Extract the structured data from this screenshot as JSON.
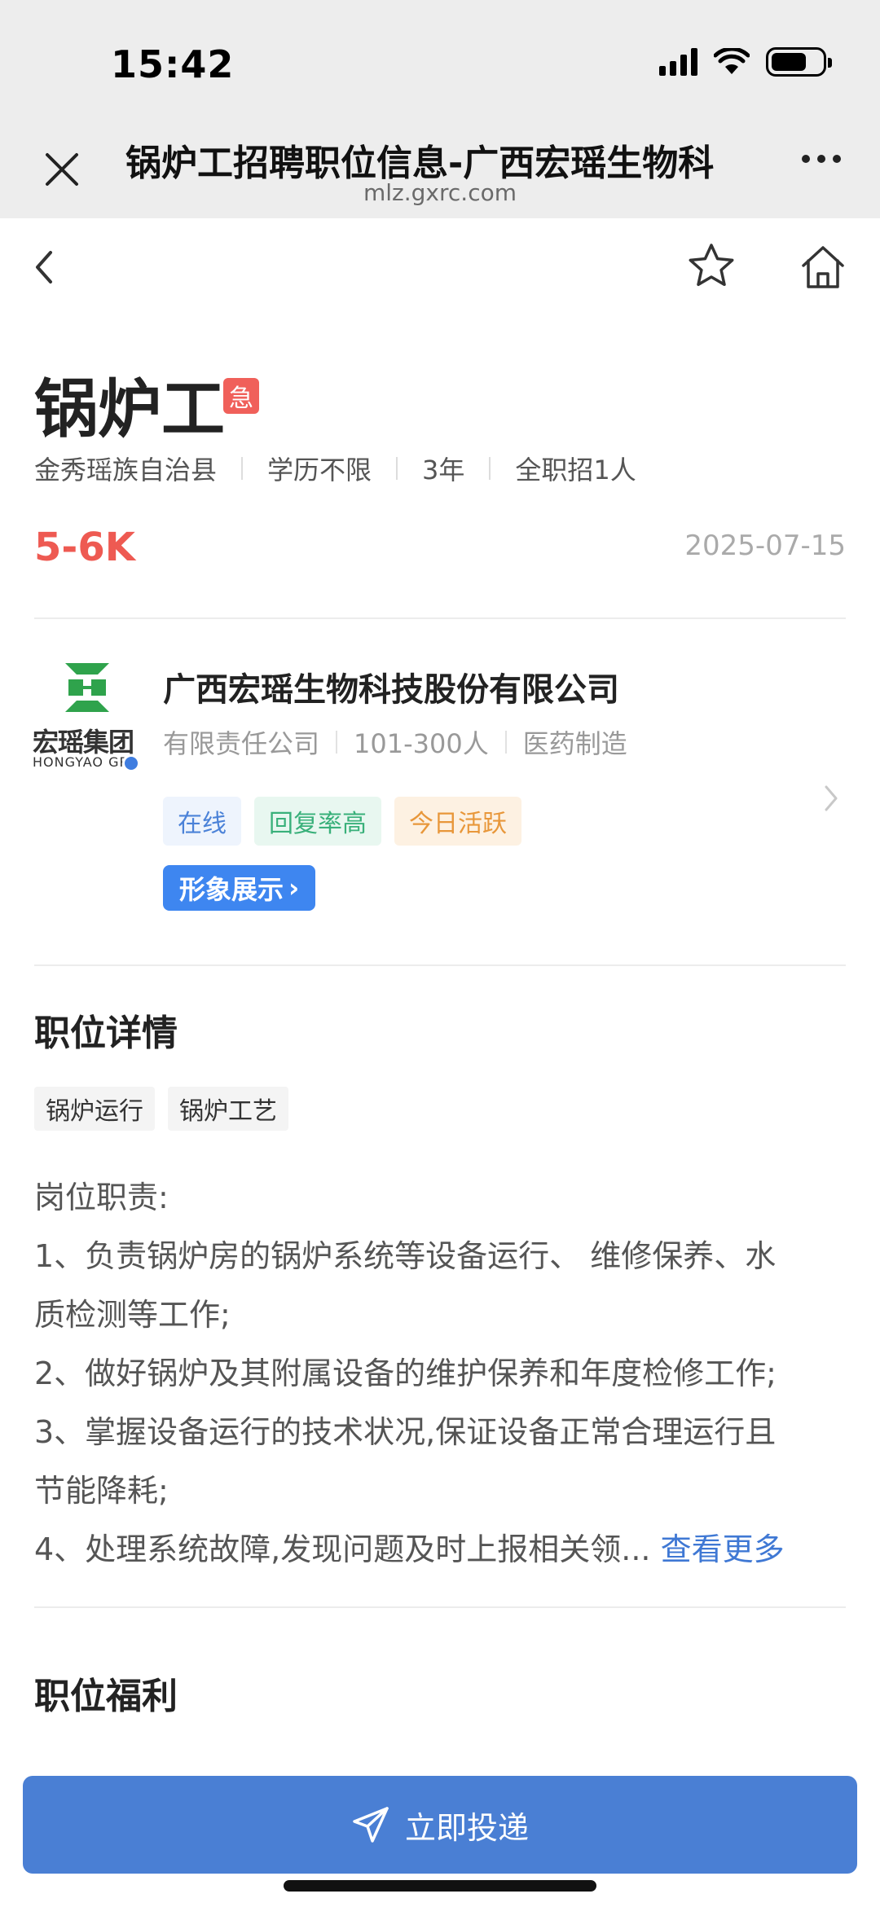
{
  "status_bar": {
    "time": "15:42"
  },
  "browser": {
    "title": "锅炉工招聘职位信息-广西宏瑶生物科",
    "url": "mlz.gxrc.com"
  },
  "icons": {
    "close": "close-icon",
    "more": "more-dots-icon",
    "back": "chevron-left-icon",
    "favorite": "star-icon",
    "home": "home-icon",
    "send": "paper-plane-icon"
  },
  "job": {
    "title": "锅炉工",
    "urgent_badge": "急",
    "location": "金秀瑶族自治县",
    "education": "学历不限",
    "experience": "3年",
    "type": "全职招1人",
    "salary": "5-6K",
    "date": "2025-07-15"
  },
  "company": {
    "logo_text": "宏瑶集团",
    "logo_subtext": "HONGYAO GRO",
    "name": "广西宏瑶生物科技股份有限公司",
    "kind": "有限责任公司",
    "size": "101-300人",
    "industry": "医药制造",
    "tags": [
      "在线",
      "回复率高",
      "今日活跃"
    ],
    "showcase_label": "形象展示",
    "showcase_arrow": "›"
  },
  "details": {
    "section_title": "职位详情",
    "skill_tags": [
      "锅炉运行",
      "锅炉工艺"
    ],
    "lines": [
      "岗位职责:",
      "1、负责锅炉房的锅炉系统等设备运行、 维修保养、水",
      "质检测等工作;",
      "2、做好锅炉及其附属设备的维护保养和年度检修工作;",
      "3、掌握设备运行的技术状况,保证设备正常合理运行且",
      "节能降耗;"
    ],
    "last_line": "4、处理系统故障,发现问题及时上报相关领...",
    "see_more": "查看更多"
  },
  "benefits": {
    "section_title": "职位福利"
  },
  "apply_button": {
    "label": "立即投递"
  },
  "colors": {
    "salary": "#ee5a52",
    "accent": "#4a7fd4",
    "urgent": "#f0605a",
    "logo_green": "#2fa34c"
  }
}
